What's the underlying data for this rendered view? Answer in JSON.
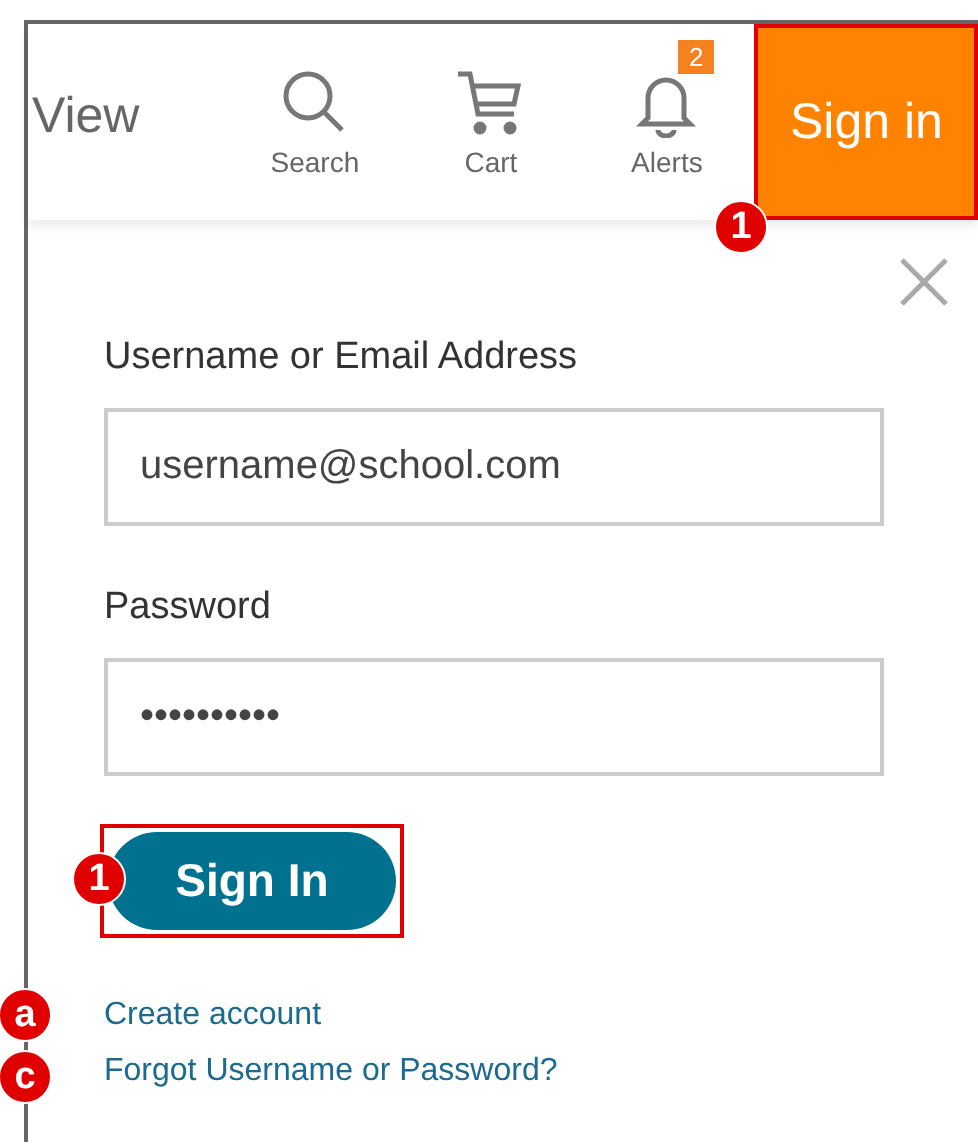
{
  "header": {
    "view_label": "View",
    "nav_items": [
      {
        "kind": "search",
        "label": "Search"
      },
      {
        "kind": "cart",
        "label": "Cart"
      },
      {
        "kind": "alerts",
        "label": "Alerts",
        "badge": "2"
      }
    ],
    "sign_in_button": {
      "label": "Sign in",
      "callout": "1"
    }
  },
  "form": {
    "fields": [
      {
        "label": "Username or Email Address",
        "value": "username@school.com"
      },
      {
        "label": "Password",
        "value": "••••••••••"
      }
    ],
    "submit": {
      "label": "Sign In",
      "callout": "1"
    },
    "links": [
      {
        "label": "Create account",
        "callout": "a"
      },
      {
        "label": "Forgot Username or Password?",
        "callout": "c"
      }
    ]
  }
}
